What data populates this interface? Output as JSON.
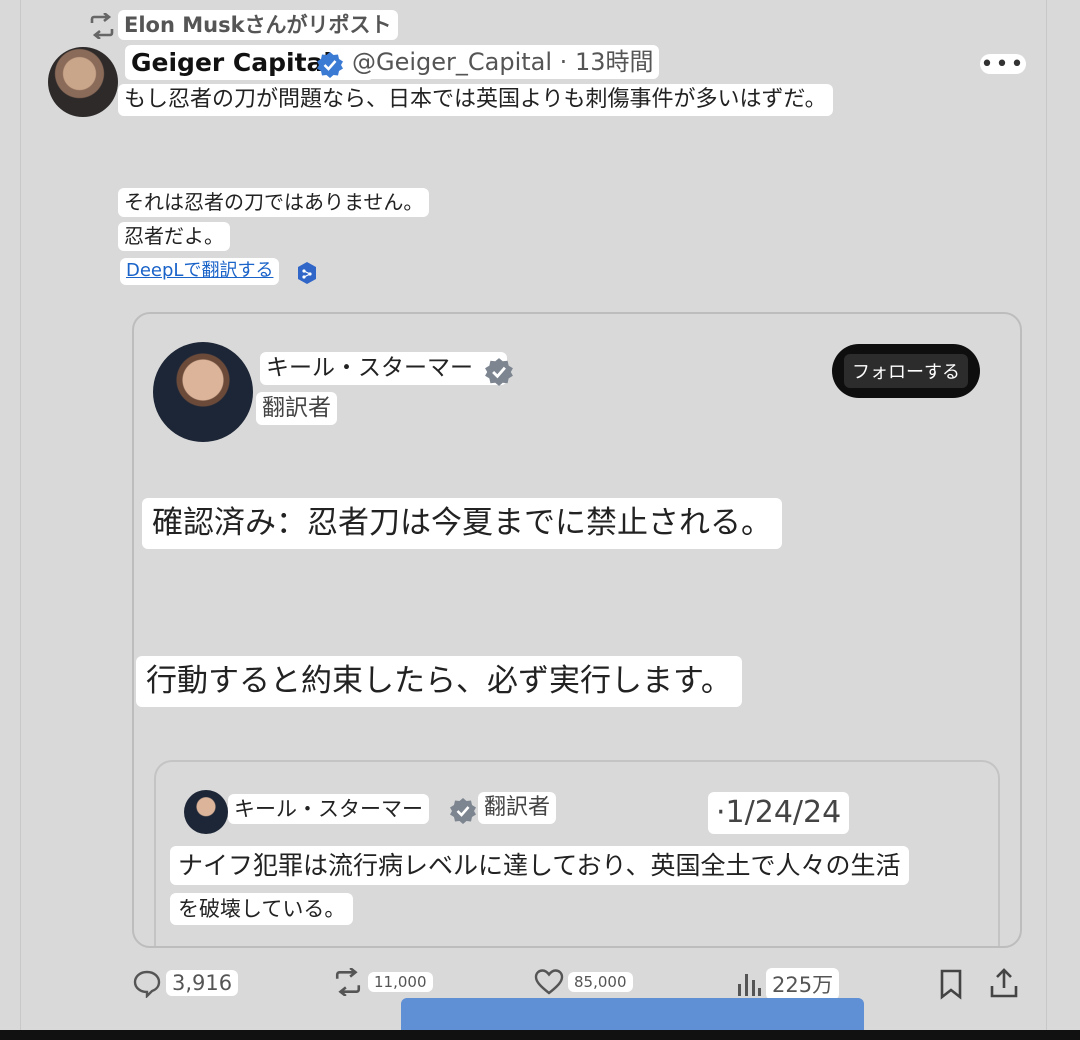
{
  "retweet": {
    "label": "Elon Muskさんがリポスト",
    "icon": "retweet-icon"
  },
  "tweet": {
    "author": "Geiger Capital",
    "handle_time": "@Geiger_Capital · 13時間",
    "more_label": "•••",
    "line1": "もし忍者の刀が問題なら、日本では英国よりも刺傷事件が多いはずだ。",
    "line2": "それは忍者の刀ではありません。",
    "line3": "忍者だよ。",
    "translate": "DeepLで翻訳する"
  },
  "quote": {
    "name": "キール・スターマー",
    "role": "翻訳者",
    "follow": "フォローする",
    "text1": "確認済み：忍者刀は今夏までに禁止される。",
    "text2": "行動すると約束したら、必ず実行します。",
    "inner": {
      "name": "キール・スターマー",
      "role": "翻訳者",
      "date": "·1/24/24",
      "text1": "ナイフ犯罪は流行病レベルに達しており、英国全土で人々の生活",
      "text2": "を破壊している。"
    }
  },
  "actions": {
    "replies": "3,916",
    "retweets": "11,000",
    "likes": "85,000",
    "views": "225万"
  },
  "colors": {
    "accent": "#1d9bf0",
    "verified": "#3b7bd4",
    "link": "#1a63c9"
  }
}
